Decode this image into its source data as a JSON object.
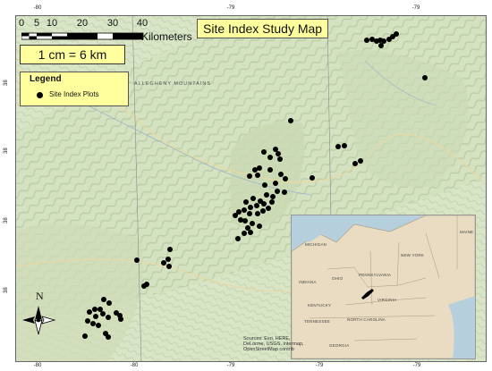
{
  "title": "Site Index Study Map",
  "scale": {
    "numbers": [
      "0",
      "5",
      "10",
      "20",
      "30",
      "40"
    ],
    "unit": "Kilometers",
    "ratio": "1 cm = 6 km"
  },
  "legend": {
    "title": "Legend",
    "item": "Site Index Plots"
  },
  "north_label": "N",
  "axis": {
    "top_ticks": [
      "-80",
      "-79",
      "-79"
    ],
    "bottom_ticks": [
      "-80",
      "-80",
      "-79",
      "-79",
      "-79"
    ],
    "left_ticks": [
      "38",
      "38",
      "38",
      "38"
    ],
    "right_ticks": [
      "38",
      "38",
      "38",
      "38"
    ]
  },
  "map_labels": {
    "mountains": "ALLEGHENY MOUNTAINS"
  },
  "inset": {
    "labels": [
      "MICHIGAN",
      "NEW YORK",
      "MAINE",
      "PENNSYLVANIA",
      "INDIANA",
      "OHIO",
      "KENTUCKY",
      "VIRGINIA",
      "TENNESSEE",
      "NORTH CAROLINA",
      "GEORGIA"
    ]
  },
  "attribution": "Sources: Esri, HERE, DeLorme, USGS, Intermap, OpenStreetMap contrib",
  "colors": {
    "title_bg": "#ffff9e",
    "terrain": "#dfe8cf",
    "water": "#b6cfdd",
    "plot": "#000000"
  }
}
